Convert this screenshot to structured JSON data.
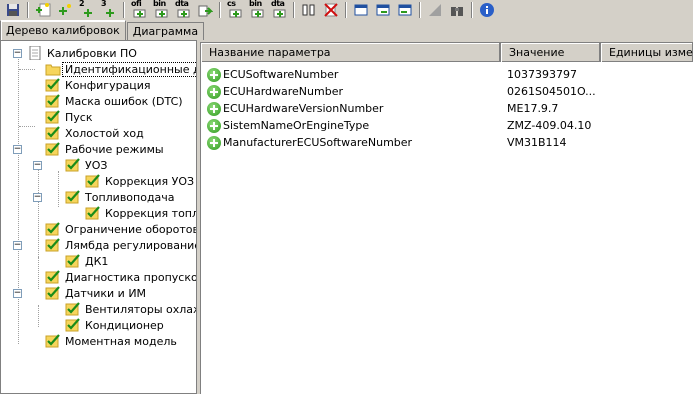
{
  "toolbar": {
    "labels": {
      "b3": "2",
      "b4": "3",
      "b5": "ofi",
      "b6": "bin",
      "b7": "dta",
      "b10": "cs",
      "b11": "bin",
      "b12": "dta"
    },
    "icons": [
      "save-icon",
      "new-icon",
      "add-icon",
      "add2-icon",
      "add3-icon",
      "ofi-icon",
      "bin-icon",
      "dta-icon",
      "export-icon",
      "cs-export-icon",
      "bin-export-icon",
      "dta-export-icon",
      "compare-icon",
      "delete-icon",
      "window-icon",
      "window-next-icon",
      "window-prev-icon",
      "chart-icon",
      "binoculars-icon",
      "info-icon"
    ]
  },
  "tabs": [
    {
      "label": "Дерево калибровок",
      "active": true
    },
    {
      "label": "Диаграмма",
      "active": false
    }
  ],
  "tree": [
    {
      "label": "Калибровки ПО",
      "icon": "document-icon"
    },
    {
      "label": "Идентификационные данные",
      "icon": "folder-icon",
      "selected": true
    },
    {
      "label": "Конфигурация",
      "icon": "checked-icon"
    },
    {
      "label": "Маска ошибок (DTC)",
      "icon": "checked-icon"
    },
    {
      "label": "Пуск",
      "icon": "checked-icon"
    },
    {
      "label": "Холостой ход",
      "icon": "checked-icon"
    },
    {
      "label": "Рабочие режимы",
      "icon": "checked-icon"
    },
    {
      "label": "УОЗ",
      "icon": "checked-icon"
    },
    {
      "label": "Коррекция УОЗ в",
      "icon": "checked-icon"
    },
    {
      "label": "Топливоподача",
      "icon": "checked-icon"
    },
    {
      "label": "Коррекция топливо",
      "icon": "checked-icon"
    },
    {
      "label": "Ограничение оборотов",
      "icon": "checked-icon"
    },
    {
      "label": "Лямбда регулирование",
      "icon": "checked-icon"
    },
    {
      "label": "ДК1",
      "icon": "checked-icon"
    },
    {
      "label": "Диагностика пропусков в",
      "icon": "checked-icon"
    },
    {
      "label": "Датчики и ИМ",
      "icon": "checked-icon"
    },
    {
      "label": "Вентиляторы охлаждения",
      "icon": "checked-icon"
    },
    {
      "label": "Кондиционер",
      "icon": "checked-icon"
    },
    {
      "label": "Моментная модель",
      "icon": "checked-icon"
    }
  ],
  "list": {
    "columns": [
      "Название параметра",
      "Значение",
      "Единицы изме..."
    ],
    "rows": [
      {
        "name": "ECUSoftwareNumber",
        "value": "1037393797",
        "unit": ""
      },
      {
        "name": "ECUHardwareNumber",
        "value": "0261S04501O...",
        "unit": ""
      },
      {
        "name": "ECUHardwareVersionNumber",
        "value": "ME17.9.7",
        "unit": ""
      },
      {
        "name": "SistemNameOrEngineType",
        "value": "ZMZ-409.04.10",
        "unit": ""
      },
      {
        "name": "ManufacturerECUSoftwareNumber",
        "value": "VM31B114",
        "unit": ""
      }
    ]
  }
}
